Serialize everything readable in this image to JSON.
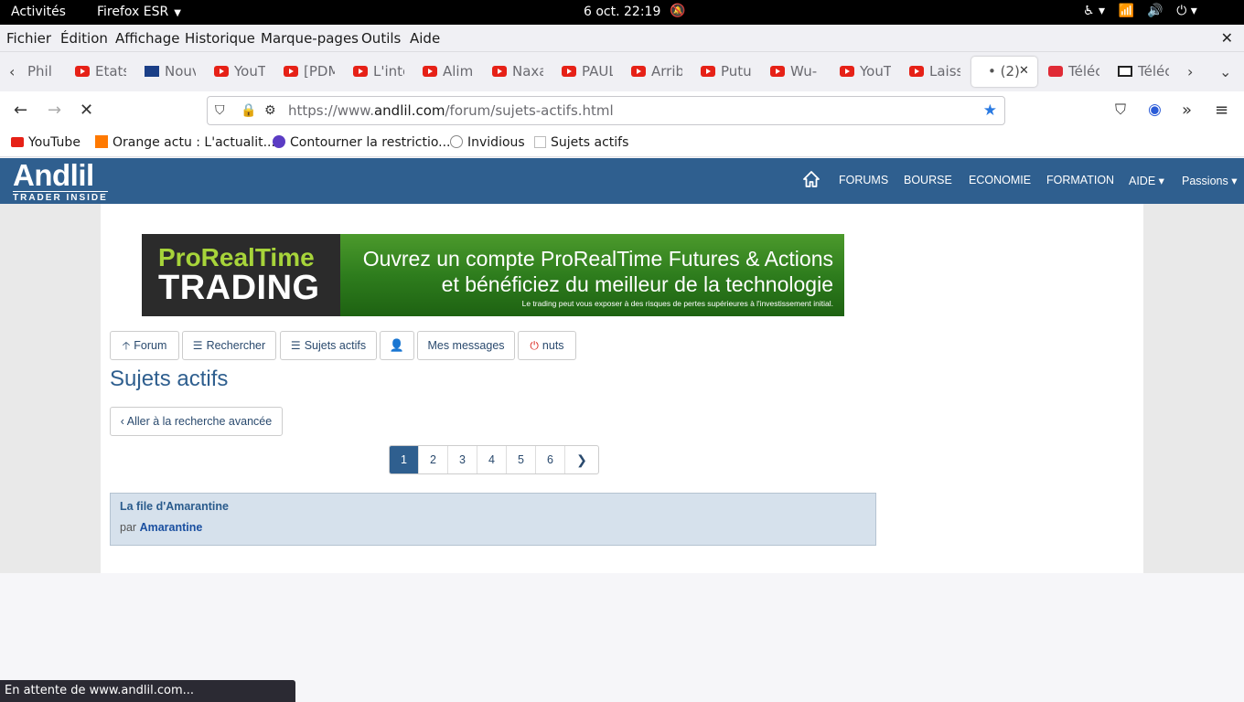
{
  "topbar": {
    "activities": "Activités",
    "app": "Firefox ESR",
    "datetime": "6 oct.  22:19"
  },
  "menubar": {
    "items": [
      "Fichier",
      "Édition",
      "Affichage",
      "Historique",
      "Marque-pages",
      "Outils",
      "Aide"
    ]
  },
  "tabs": [
    {
      "label": "Philip"
    },
    {
      "label": "Etats"
    },
    {
      "label": "Nouv"
    },
    {
      "label": "YouT"
    },
    {
      "label": "[PDM"
    },
    {
      "label": "L'inte"
    },
    {
      "label": "Alime"
    },
    {
      "label": "Naxa"
    },
    {
      "label": "PAUL"
    },
    {
      "label": "Arrib"
    },
    {
      "label": "Putu"
    },
    {
      "label": "Wu-"
    },
    {
      "label": "YouT"
    },
    {
      "label": "Laiss"
    },
    {
      "label": "• (2)"
    },
    {
      "label": "Téléc"
    },
    {
      "label": "Téléc"
    }
  ],
  "urlbar": {
    "prefix": "https://www.",
    "domain": "andlil.com",
    "path": "/forum/sujets-actifs.html"
  },
  "bookmarks": [
    "YouTube",
    "Orange actu : L'actualit...",
    "Contourner la restrictio...",
    "Invidious",
    "Sujets actifs"
  ],
  "site": {
    "logo": "Andlil",
    "tagline": "TRADER INSIDE",
    "nav": [
      "FORUMS",
      "BOURSE",
      "ECONOMIE",
      "FORMATION",
      "AIDE ▾",
      "Passions ▾"
    ]
  },
  "banner": {
    "brand1": "ProRealTime",
    "brand2": "TRADING",
    "line1": "Ouvrez un compte ProRealTime Futures & Actions",
    "line2": "et bénéficiez du meilleur de la technologie",
    "disclaimer": "Le trading peut vous exposer à des risques de pertes supérieures à l'investissement initial."
  },
  "buttons": {
    "forum": "Forum",
    "search": "Rechercher",
    "active": "Sujets actifs",
    "messages": "Mes messages",
    "user": "nuts"
  },
  "page": {
    "title": "Sujets actifs",
    "advanced": "Aller à la recherche avancée",
    "pages": [
      "1",
      "2",
      "3",
      "4",
      "5",
      "6"
    ]
  },
  "topic": {
    "title": "La file d'Amarantine",
    "by": "par",
    "author": "Amarantine"
  },
  "status": "En attente de www.andlil.com..."
}
